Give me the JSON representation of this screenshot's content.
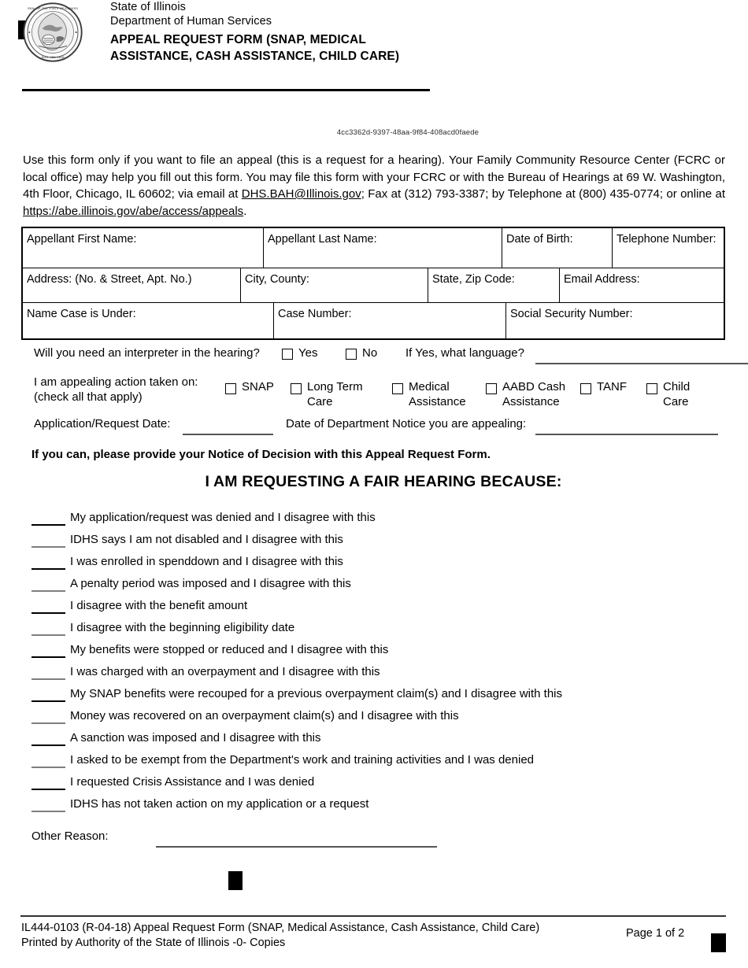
{
  "document": {
    "uuid": "4cc3362d-9397-48aa-9f84-408acd0faede"
  },
  "header": {
    "agency_line1": "State of Illinois",
    "agency_line2": "Department of Human Services",
    "title_line1": "APPEAL REQUEST FORM (SNAP, MEDICAL",
    "title_line2": "ASSISTANCE, CASH ASSISTANCE, CHILD CARE)",
    "seal_label": "seal-of-the-state-of-illinois"
  },
  "intro": {
    "part1": "Use this form only if you want to file an appeal (this is a request for a hearing). Your Family Community Resource Center (FCRC or local office) may help you fill out this form. You may file this form with your FCRC or with the Bureau of Hearings at 69 W. Washington, 4th Floor, Chicago, IL 60602; via email at ",
    "email": "DHS.BAH@Illinois.gov",
    "part2": "; Fax at (312) 793-3387; by Telephone at (800) 435-0774; or online at ",
    "url": "https://abe.illinois.gov/abe/access/appeals",
    "part3": "."
  },
  "grid": {
    "row1": [
      {
        "label": "Appellant First Name:",
        "value": ""
      },
      {
        "label": "Appellant Last Name:",
        "value": ""
      },
      {
        "label": "Date of Birth:",
        "value": ""
      },
      {
        "label": "Telephone Number:",
        "value": ""
      }
    ],
    "row2": [
      {
        "label": "Address: (No. & Street, Apt. No.)",
        "value": ""
      },
      {
        "label": "City, County:",
        "value": ""
      },
      {
        "label": "State, Zip Code:",
        "value": ""
      },
      {
        "label": "Email Address:",
        "value": ""
      }
    ],
    "row3": [
      {
        "label": "Name Case is Under:",
        "value": ""
      },
      {
        "label": "Case Number:",
        "value": ""
      },
      {
        "label": "Social Security Number:",
        "value": ""
      }
    ]
  },
  "interpreter": {
    "question": "Will you need an interpreter in the hearing?",
    "yes_label": "Yes",
    "no_label": "No",
    "yes_checked": false,
    "no_checked": false,
    "language_question": "If Yes, what language?",
    "language_value": ""
  },
  "appealing": {
    "lead_line1": "I am appealing action taken on:",
    "lead_line2": "(check all that apply)",
    "options": [
      {
        "label": "SNAP",
        "label2": "",
        "checked": false
      },
      {
        "label": "Long Term",
        "label2": "Care",
        "checked": false
      },
      {
        "label": "Medical",
        "label2": "Assistance",
        "checked": false
      },
      {
        "label": "AABD Cash",
        "label2": "Assistance",
        "checked": false
      },
      {
        "label": "TANF",
        "label2": "",
        "checked": false
      },
      {
        "label": "Child",
        "label2": "Care",
        "checked": false
      }
    ]
  },
  "dates": {
    "application_label": "Application/Request Date:",
    "application_value": "",
    "notice_label": "Date of Department Notice you are appealing:",
    "notice_value": ""
  },
  "notice_line": "If you can, please provide your Notice of Decision with this Appeal Request Form.",
  "section_heading": "I AM REQUESTING A FAIR HEARING BECAUSE:",
  "reasons": [
    {
      "text": "My application/request was denied and I disagree with this",
      "checked": false,
      "weight": "dark"
    },
    {
      "text": "IDHS says I am not disabled and I disagree with this",
      "checked": false,
      "weight": "light"
    },
    {
      "text": "I was enrolled in spenddown and I disagree with this",
      "checked": false,
      "weight": "dark"
    },
    {
      "text": "A penalty period was imposed and I disagree with this",
      "checked": false,
      "weight": "light"
    },
    {
      "text": "I disagree with the benefit amount",
      "checked": false,
      "weight": "dark"
    },
    {
      "text": "I disagree with the beginning eligibility date",
      "checked": false,
      "weight": "light"
    },
    {
      "text": "My benefits were stopped or reduced and I disagree with this",
      "checked": false,
      "weight": "dark"
    },
    {
      "text": "I was charged with an overpayment and I disagree with this",
      "checked": false,
      "weight": "light"
    },
    {
      "text": "My SNAP benefits were recouped for a previous overpayment claim(s) and I disagree with this",
      "checked": false,
      "weight": "dark"
    },
    {
      "text": "Money was recovered on an overpayment claim(s) and I disagree with this",
      "checked": false,
      "weight": "light"
    },
    {
      "text": "A sanction was imposed and I disagree with this",
      "checked": false,
      "weight": "dark"
    },
    {
      "text": "I asked to be exempt from the Department's work and training activities and I was denied",
      "checked": false,
      "weight": "light"
    },
    {
      "text": "I requested Crisis Assistance and I was denied",
      "checked": false,
      "weight": "dark"
    },
    {
      "text": "IDHS has not taken action on my application or a request",
      "checked": false,
      "weight": "light"
    }
  ],
  "other_reason": {
    "label": "Other Reason:",
    "value": ""
  },
  "footer": {
    "line1": "IL444-0103 (R-04-18) Appeal Request Form (SNAP, Medical Assistance, Cash Assistance, Child Care)",
    "line2": "Printed by Authority of the State of Illinois   -0- Copies",
    "page": "Page 1 of 2"
  }
}
